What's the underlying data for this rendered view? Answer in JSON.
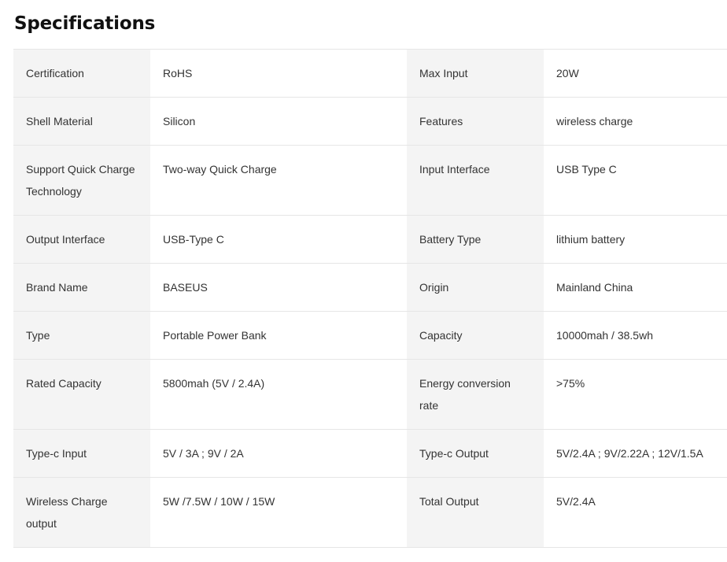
{
  "page": {
    "title": "Specifications"
  },
  "specs": [
    {
      "label1": "Certification",
      "value1": "RoHS",
      "label2": "Max Input",
      "value2": "20W"
    },
    {
      "label1": "Shell Material",
      "value1": "Silicon",
      "label2": "Features",
      "value2": "wireless charge"
    },
    {
      "label1": "Support Quick Charge Technology",
      "value1": "Two-way Quick Charge",
      "label2": "Input Interface",
      "value2": "USB Type C"
    },
    {
      "label1": "Output Interface",
      "value1": "USB-Type C",
      "label2": "Battery Type",
      "value2": "lithium battery"
    },
    {
      "label1": "Brand Name",
      "value1": "BASEUS",
      "label2": "Origin",
      "value2": "Mainland China"
    },
    {
      "label1": "Type",
      "value1": "Portable Power Bank",
      "label2": "Capacity",
      "value2": "10000mah / 38.5wh"
    },
    {
      "label1": "Rated Capacity",
      "value1": "5800mah (5V / 2.4A)",
      "label2": "Energy conversion rate",
      "value2": ">75%"
    },
    {
      "label1": "Type-c Input",
      "value1": "5V / 3A ; 9V / 2A",
      "label2": "Type-c Output",
      "value2": "5V/2.4A ; 9V/2.22A ; 12V/1.5A"
    },
    {
      "label1": "Wireless Charge output",
      "value1": "5W /7.5W / 10W / 15W",
      "label2": "Total Output",
      "value2": "5V/2.4A"
    }
  ]
}
